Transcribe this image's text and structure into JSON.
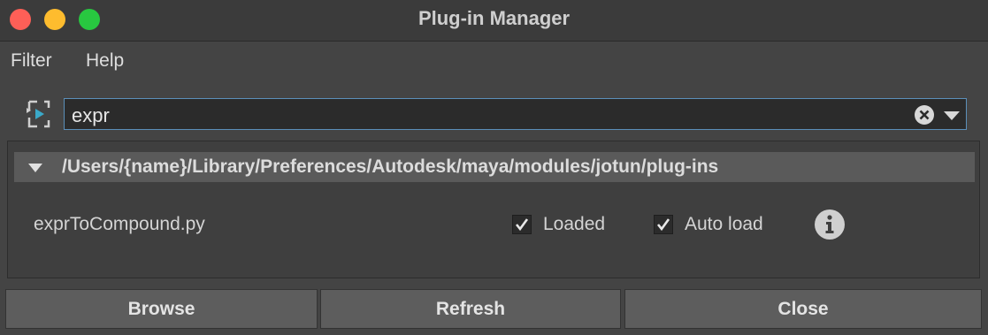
{
  "window": {
    "title": "Plug-in Manager"
  },
  "menu": {
    "items": [
      {
        "label": "Filter"
      },
      {
        "label": "Help"
      }
    ]
  },
  "search": {
    "value": "expr"
  },
  "group": {
    "path": "/Users/{name}/Library/Preferences/Autodesk/maya/modules/jotun/plug-ins"
  },
  "plugins": [
    {
      "name": "exprToCompound.py",
      "loaded_label": "Loaded",
      "loaded": true,
      "autoload_label": "Auto load",
      "autoload": true
    }
  ],
  "buttons": {
    "browse": "Browse",
    "refresh": "Refresh",
    "close": "Close"
  },
  "colors": {
    "close_light": "#fe5f57",
    "minimize_light": "#febc2e",
    "maximize_light": "#28c840",
    "accent": "#5b8fb9",
    "filter_icon_accent": "#3aa9c9"
  },
  "icons": {
    "filter": "filter-toggle-icon",
    "clear": "clear-circle-x-icon",
    "dropdown": "triangle-down-icon",
    "collapse": "triangle-down-icon",
    "info": "info-circle-icon",
    "check": "checkmark-icon"
  }
}
